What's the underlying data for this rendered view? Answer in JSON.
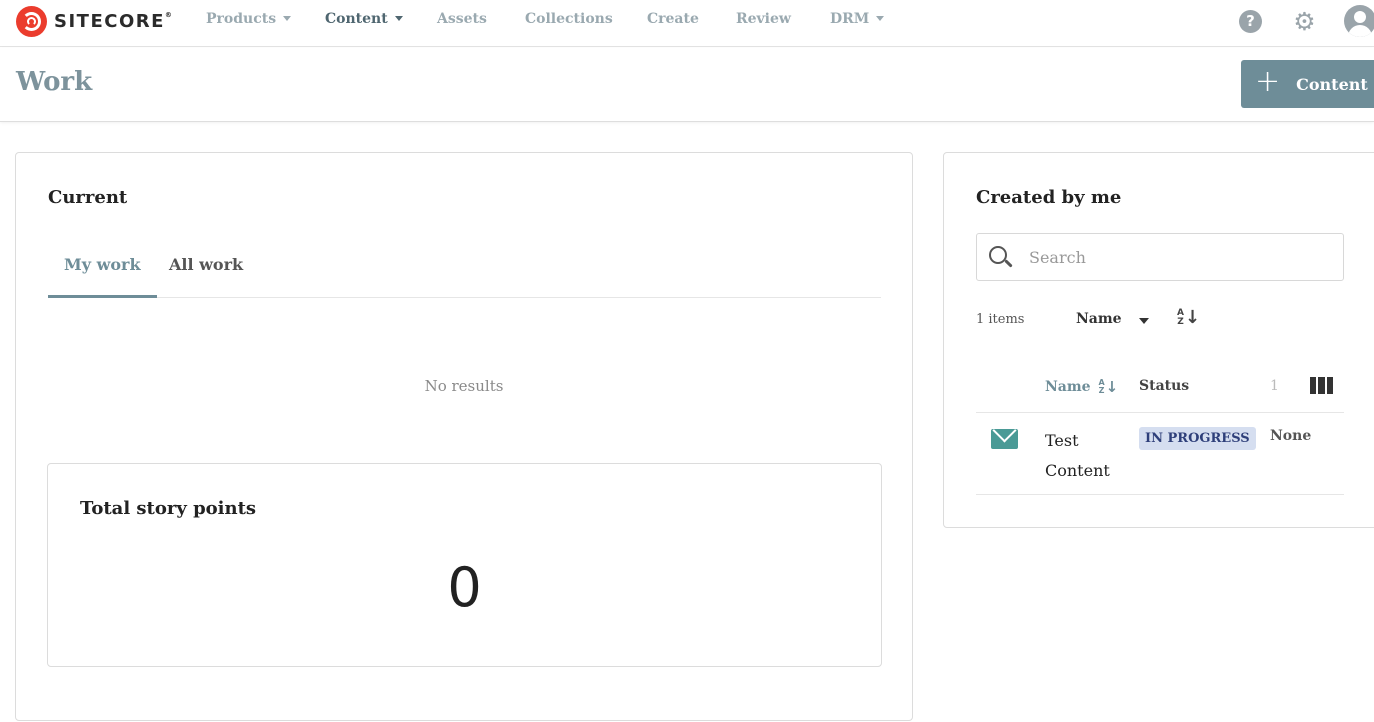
{
  "brand": {
    "name": "SITECORE",
    "mark": "®"
  },
  "nav": {
    "items": [
      {
        "label": "Products",
        "dropdown": true
      },
      {
        "label": "Content",
        "dropdown": true,
        "active": true
      },
      {
        "label": "Assets"
      },
      {
        "label": "Collections"
      },
      {
        "label": "Create"
      },
      {
        "label": "Review"
      },
      {
        "label": "DRM",
        "dropdown": true
      }
    ],
    "icons": {
      "help": "question-circle-icon",
      "settings": "gear-icon",
      "account": "user-avatar-icon"
    },
    "help_glyph": "?",
    "gear_glyph": "⚙"
  },
  "page": {
    "title": "Work",
    "add_button": {
      "icon": "plus-icon",
      "glyph": "+",
      "label": "Content"
    }
  },
  "current": {
    "title": "Current",
    "tabs": [
      {
        "label": "My work",
        "active": true
      },
      {
        "label": "All work"
      }
    ],
    "empty_text": "No results",
    "story_points": {
      "label": "Total story points",
      "value": "0"
    }
  },
  "created_by_me": {
    "title": "Created by me",
    "search_placeholder": "Search",
    "items_count": "1 items",
    "sort_by": "Name",
    "az_letters": {
      "top": "A",
      "bottom": "Z",
      "arrow": "↓"
    },
    "columns": {
      "name": "Name",
      "status": "Status",
      "third": "1"
    },
    "rows": [
      {
        "icon": "email-icon",
        "name": "Test Content",
        "status": "IN PROGRESS",
        "third": "None"
      }
    ]
  },
  "colors": {
    "accent": "#6e8d98",
    "brand": "#eb3c2d",
    "badge_bg": "#d5def0",
    "badge_text": "#2e3f7a",
    "mail": "#4a9a96"
  }
}
